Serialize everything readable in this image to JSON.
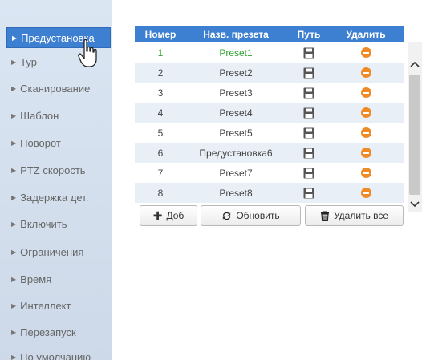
{
  "sidebar": {
    "items": [
      {
        "label": "Предустановка",
        "active": true
      },
      {
        "label": "Тур"
      },
      {
        "label": "Сканирование"
      },
      {
        "label": "Шаблон"
      },
      {
        "label": "Поворот"
      },
      {
        "label": "PTZ скорость"
      },
      {
        "label": "Задержка дет."
      },
      {
        "label": "Включить"
      },
      {
        "label": "Ограничения"
      },
      {
        "label": "Время"
      },
      {
        "label": "Интеллект"
      },
      {
        "label": "Перезапуск"
      },
      {
        "label": "По умолчанию"
      }
    ]
  },
  "table": {
    "headers": {
      "number": "Номер",
      "name": "Назв. презета",
      "path": "Путь",
      "delete": "Удалить"
    },
    "rows": [
      {
        "number": "1",
        "name": "Preset1",
        "selected": true
      },
      {
        "number": "2",
        "name": "Preset2"
      },
      {
        "number": "3",
        "name": "Preset3"
      },
      {
        "number": "4",
        "name": "Preset4"
      },
      {
        "number": "5",
        "name": "Preset5"
      },
      {
        "number": "6",
        "name": "Предустановка6"
      },
      {
        "number": "7",
        "name": "Preset7"
      },
      {
        "number": "8",
        "name": "Preset8"
      }
    ]
  },
  "buttons": {
    "add": "Доб",
    "refresh": "Обновить",
    "delete_all": "Удалить все"
  },
  "colors": {
    "accent": "#3d7fd0",
    "selected_text": "#2fa52f",
    "delete_icon": "#f08a24"
  },
  "icons": {
    "path": "save-icon",
    "delete": "minus-circle-icon",
    "add": "plus-icon",
    "refresh": "refresh-icon",
    "delete_all": "trash-icon"
  }
}
